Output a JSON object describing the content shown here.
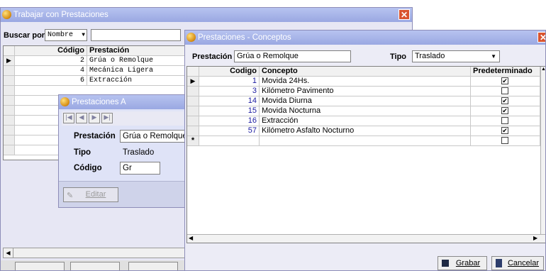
{
  "win1": {
    "title": "Trabajar con Prestaciones",
    "search_label": "Buscar por:",
    "search_field": "Nombre",
    "search_value": "",
    "grid": {
      "headers": [
        "Código",
        "Prestación"
      ],
      "rows": [
        {
          "code": "2",
          "name": "Grúa o Remolque"
        },
        {
          "code": "4",
          "name": "Mecánica Ligera"
        },
        {
          "code": "6",
          "name": "Extracción"
        }
      ]
    }
  },
  "win2": {
    "title": "Prestaciones A",
    "prestacion_label": "Prestación",
    "prestacion_value": "Grúa o Remolque",
    "tipo_label": "Tipo",
    "tipo_value": "Traslado",
    "codigo_label": "Código",
    "codigo_value": "Gr",
    "edit_button": "Editar"
  },
  "win3": {
    "title": "Prestaciones - Conceptos",
    "prestacion_label": "Prestación",
    "prestacion_value": "Grúa o Remolque",
    "tipo_label": "Tipo",
    "tipo_value": "Traslado",
    "grid": {
      "headers": [
        "Codigo",
        "Concepto",
        "Predeterminado"
      ],
      "rows": [
        {
          "code": "1",
          "concept": "Movida 24Hs.",
          "default": true
        },
        {
          "code": "3",
          "concept": "Kilómetro Pavimento",
          "default": false
        },
        {
          "code": "14",
          "concept": "Movida Diurna",
          "default": true
        },
        {
          "code": "15",
          "concept": "Movida Nocturna",
          "default": true
        },
        {
          "code": "16",
          "concept": "Extracción",
          "default": false
        },
        {
          "code": "57",
          "concept": "Kilómetro Asfalto Nocturno",
          "default": true
        }
      ],
      "new_row_marker": "*"
    },
    "save_button": "Grabar",
    "cancel_button": "Cancelar"
  }
}
